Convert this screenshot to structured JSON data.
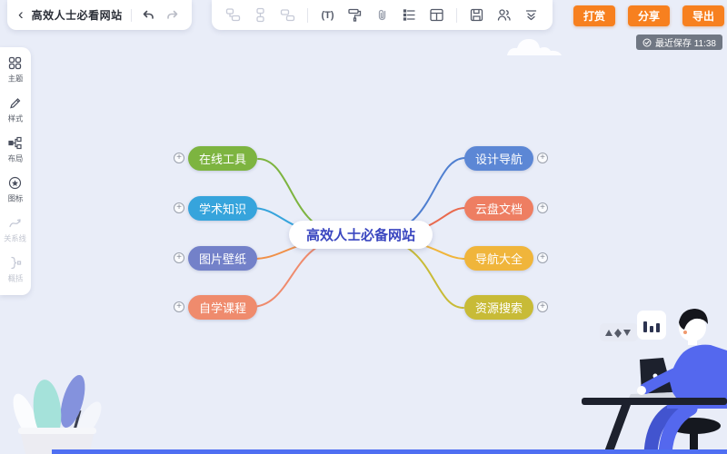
{
  "header": {
    "back_icon": "‹",
    "title": "高效人士必看网站",
    "actions": [
      {
        "label": "打赏"
      },
      {
        "label": "分享"
      },
      {
        "label": "导出"
      }
    ],
    "save_status": "最近保存 11:38"
  },
  "toolbar_icons": {
    "node_group": [
      "insert-topic-before",
      "insert-subtopic",
      "insert-sibling-topic"
    ],
    "tool_group": [
      "text",
      "format-painter",
      "attachment",
      "outline",
      "table"
    ],
    "file_group": [
      "save",
      "collaborate",
      "collapse-toolbar"
    ],
    "text_tool_glyph": "(T)"
  },
  "sidebar": {
    "items": [
      {
        "label": "主题",
        "icon": "theme-grid-icon",
        "enabled": true
      },
      {
        "label": "样式",
        "icon": "style-pen-icon",
        "enabled": true
      },
      {
        "label": "布局",
        "icon": "layout-structure-icon",
        "enabled": true
      },
      {
        "label": "图标",
        "icon": "star-circle-icon",
        "enabled": true
      },
      {
        "label": "关系线",
        "icon": "relation-line-icon",
        "enabled": false
      },
      {
        "label": "概括",
        "icon": "summary-brace-icon",
        "enabled": false
      }
    ]
  },
  "mindmap": {
    "root": {
      "label": "高效人士必备网站",
      "text_color": "#3a46c0",
      "bg": "#ffffff"
    },
    "left_branches": [
      {
        "label": "在线工具",
        "bg": "#7db440",
        "line": "#7db440"
      },
      {
        "label": "学术知识",
        "bg": "#36a4dc",
        "line": "#36a4dc"
      },
      {
        "label": "图片壁纸",
        "bg": "#7381c9",
        "line": "#f09048"
      },
      {
        "label": "自学课程",
        "bg": "#ef8b6d",
        "line": "#ef8b6d"
      }
    ],
    "right_branches": [
      {
        "label": "设计导航",
        "bg": "#5c87d5",
        "line": "#4f7fd0"
      },
      {
        "label": "云盘文档",
        "bg": "#ee7e62",
        "line": "#e96a4e"
      },
      {
        "label": "导航大全",
        "bg": "#f0b53b",
        "line": "#f0b53b"
      },
      {
        "label": "资源搜索",
        "bg": "#c8bb37",
        "line": "#c8bb37"
      }
    ]
  },
  "colors": {
    "canvas_bg": "#e9edf8",
    "accent_orange": "#f7801f",
    "badge_bg": "rgba(95,102,114,0.88)",
    "bottom_bar": "#4f6ff2"
  }
}
